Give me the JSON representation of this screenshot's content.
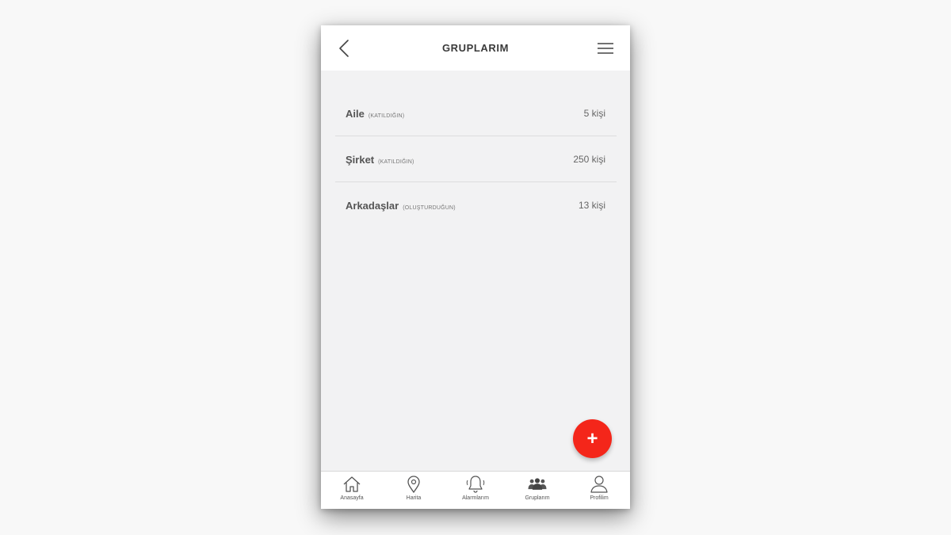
{
  "header": {
    "title": "GRUPLARIM"
  },
  "groups": [
    {
      "name": "Aile",
      "role": "(KATILDIĞIN)",
      "count": "5 kişi"
    },
    {
      "name": "Şirket",
      "role": "(KATILDIĞIN)",
      "count": "250 kişi"
    },
    {
      "name": "Arkadaşlar",
      "role": "(OLUŞTURDUĞUN)",
      "count": "13 kişi"
    }
  ],
  "fab": {
    "label": "+"
  },
  "tabbar": {
    "items": [
      {
        "label": "Anasayfa",
        "icon": "home-icon"
      },
      {
        "label": "Harita",
        "icon": "map-pin-icon"
      },
      {
        "label": "Alarmlarım",
        "icon": "bell-icon"
      },
      {
        "label": "Gruplarım",
        "icon": "groups-icon"
      },
      {
        "label": "Profilim",
        "icon": "user-icon"
      }
    ],
    "active_index": 3
  },
  "colors": {
    "accent": "#f4261a",
    "background": "#f2f2f3",
    "header": "#ffffff"
  }
}
